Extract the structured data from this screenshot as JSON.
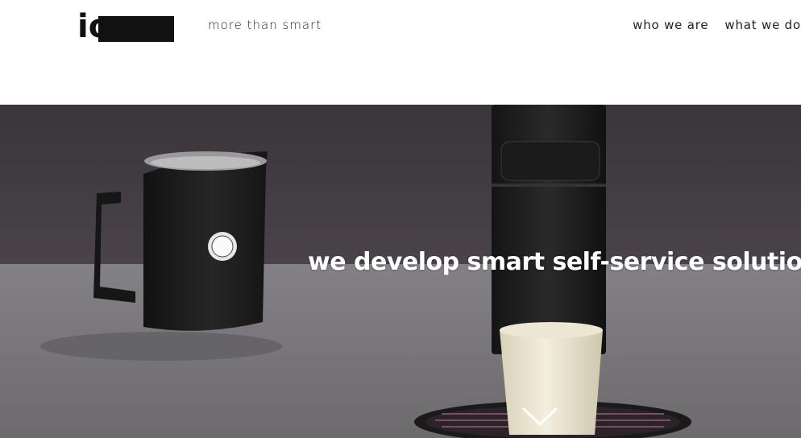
{
  "brand": {
    "logo_text": "iovent",
    "tagline": "more than smart"
  },
  "nav": {
    "items": [
      {
        "label": "who we are"
      },
      {
        "label": "what we do"
      }
    ]
  },
  "hero": {
    "headline": "we develop smart self-service solutions",
    "scroll_icon": "chevron-down-icon"
  },
  "colors": {
    "background": "#ffffff",
    "text": "#222222",
    "hero_wall": "#3f393f",
    "hero_counter": "#7b797c",
    "headline": "#ffffff"
  }
}
